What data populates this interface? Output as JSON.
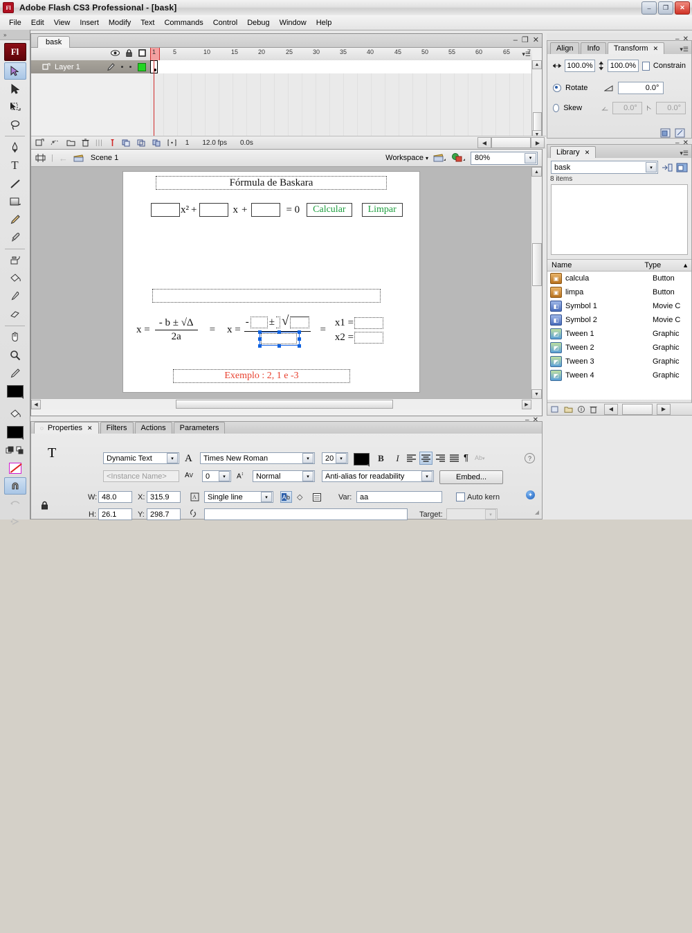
{
  "window": {
    "title": "Adobe Flash CS3 Professional - [bask]",
    "app_icon": "Fl",
    "minimize": "–",
    "restore": "❐",
    "close": "✕"
  },
  "menubar": {
    "items": [
      "File",
      "Edit",
      "View",
      "Insert",
      "Modify",
      "Text",
      "Commands",
      "Control",
      "Debug",
      "Window",
      "Help"
    ]
  },
  "toolbox": {
    "badge": "Fl",
    "collapse_icon": "»",
    "tools": [
      {
        "name": "selection-tool",
        "glyph": "➤",
        "selected": true
      },
      {
        "name": "subselection-tool",
        "glyph": "➤"
      },
      {
        "name": "free-transform-tool",
        "glyph": "▣"
      },
      {
        "name": "lasso-tool",
        "glyph": "◯"
      },
      {
        "name": "pen-tool",
        "glyph": "✒"
      },
      {
        "name": "text-tool",
        "glyph": "T"
      },
      {
        "name": "line-tool",
        "glyph": "╱"
      },
      {
        "name": "rectangle-tool",
        "glyph": "▭"
      },
      {
        "name": "pencil-tool",
        "glyph": "✎"
      },
      {
        "name": "brush-tool",
        "glyph": "🖌"
      },
      {
        "name": "ink-bottle-tool",
        "glyph": "🎨"
      },
      {
        "name": "paint-bucket-tool",
        "glyph": "🪣"
      },
      {
        "name": "eyedropper-tool",
        "glyph": "💧"
      },
      {
        "name": "eraser-tool",
        "glyph": "▰"
      },
      {
        "name": "hand-tool",
        "glyph": "✋"
      },
      {
        "name": "zoom-tool",
        "glyph": "🔍"
      }
    ],
    "stroke_color": "#000000",
    "fill_color": "#000000",
    "no_color_label": "no-color",
    "snap_to_objects": "magnet"
  },
  "document": {
    "tab_label": "bask",
    "minimize": "–",
    "restore": "❐",
    "close": "✕"
  },
  "timeline": {
    "column_icons": [
      "eye-icon",
      "lock-icon",
      "outline-icon"
    ],
    "ruler_ticks": [
      "1",
      "5",
      "10",
      "15",
      "20",
      "25",
      "30",
      "35",
      "40",
      "45",
      "50",
      "55",
      "60",
      "65",
      "7"
    ],
    "layers": [
      {
        "name": "Layer 1",
        "selected": true,
        "pencil": "✎",
        "visible_dot": "•",
        "lock_dot": "•",
        "outline_color": "#22d422"
      }
    ],
    "status": {
      "current_frame": "1",
      "fps": "12.0 fps",
      "elapsed": "0.0s",
      "onion_tools": [
        "onion-skin",
        "onion-skin-outlines",
        "edit-multiple-frames",
        "modify-onion-markers"
      ],
      "layer_tools": [
        "new-layer",
        "add-motion-guide",
        "new-folder",
        "delete-layer"
      ]
    }
  },
  "editbar": {
    "scene_label": "Scene 1",
    "workspace_label": "Workspace",
    "zoom_value": "80%",
    "back_arrow": "←",
    "edit_scene_icon": "edit-scene-icon",
    "edit_symbol_icon": "edit-symbol-icon"
  },
  "stage": {
    "title": "Fórmula de Baskara",
    "equation": {
      "x_squared": "x²",
      "plus1": "+",
      "x_term": "x",
      "plus2": "+",
      "equals_zero": "= 0"
    },
    "buttons": {
      "calcular": "Calcular",
      "limpar": "Limpar",
      "button_text_color": "#1d9e3e"
    },
    "formula": {
      "x_label": "x =",
      "numerator": "- b ±  √Δ",
      "denominator": "2a",
      "equals1": "=",
      "x_label2": "x =",
      "minus": "-",
      "plus_minus": "±",
      "radical": "√",
      "denominator2": "",
      "equals2": "=",
      "x1_label": "x1 =",
      "x2_label": "x2 ="
    },
    "example_text": "Exemplo : 2, 1 e -3",
    "example_color": "#e8402e"
  },
  "transform_panel": {
    "tabs": [
      "Align",
      "Info",
      "Transform"
    ],
    "active_tab": "Transform",
    "scale_w": "100.0%",
    "scale_h": "100.0%",
    "constrain_label": "Constrain",
    "constrain_checked": false,
    "rotate_label": "Rotate",
    "rotate_selected": true,
    "rotate_value": "0.0°",
    "skew_label": "Skew",
    "skew_selected": false,
    "skew_value_1": "0.0°",
    "skew_value_2": "0.0°",
    "copy_apply_icon": "copy-and-apply-transform-icon",
    "reset_icon": "reset-transform-icon"
  },
  "library_panel": {
    "tab": "Library",
    "document_name": "bask",
    "item_count": "8 items",
    "columns": [
      "Name",
      "Type"
    ],
    "new_symbol_icon": "new-symbol-icon",
    "new_folder_icon": "new-folder-icon",
    "items": [
      {
        "name": "calcula",
        "type": "Button",
        "icon": "button-icon"
      },
      {
        "name": "limpa",
        "type": "Button",
        "icon": "button-icon"
      },
      {
        "name": "Symbol 1",
        "type": "Movie C",
        "icon": "movieclip-icon"
      },
      {
        "name": "Symbol 2",
        "type": "Movie C",
        "icon": "movieclip-icon"
      },
      {
        "name": "Tween 1",
        "type": "Graphic",
        "icon": "graphic-icon"
      },
      {
        "name": "Tween 2",
        "type": "Graphic",
        "icon": "graphic-icon"
      },
      {
        "name": "Tween 3",
        "type": "Graphic",
        "icon": "graphic-icon"
      },
      {
        "name": "Tween 4",
        "type": "Graphic",
        "icon": "graphic-icon"
      }
    ]
  },
  "properties_panel": {
    "tabs": [
      "Properties",
      "Filters",
      "Actions",
      "Parameters"
    ],
    "active_tab": "Properties",
    "type_icon": "T",
    "text_type": "Dynamic Text",
    "instance_name_placeholder": "<Instance Name>",
    "font_family": "Times New Roman",
    "font_size": "20",
    "letter_spacing": "0",
    "font_style": "Normal",
    "antialias": "Anti-alias for readability",
    "embed_label": "Embed...",
    "bold": "B",
    "italic": "I",
    "align_icons": [
      "align-left",
      "align-center",
      "align-right",
      "align-justify"
    ],
    "paragraph_icon": "¶",
    "format_icon": "format-options-icon",
    "w_label": "W:",
    "w_value": "48.0",
    "h_label": "H:",
    "h_value": "26.1",
    "x_label": "X:",
    "x_value": "315.9",
    "y_label": "Y:",
    "y_value": "298.7",
    "line_type": "Single line",
    "var_label": "Var:",
    "var_value": "aa",
    "target_label": "Target:",
    "target_value": "",
    "url_link_value": "",
    "auto_kern_label": "Auto kern",
    "auto_kern_checked": false,
    "lock_icon": "lock-icon",
    "selectable_icon": "selectable-icon",
    "render_html_icon": "render-as-html-icon",
    "border_icon": "show-border-icon",
    "help_icon": "?",
    "accessibility_icon": "accessibility-icon"
  }
}
